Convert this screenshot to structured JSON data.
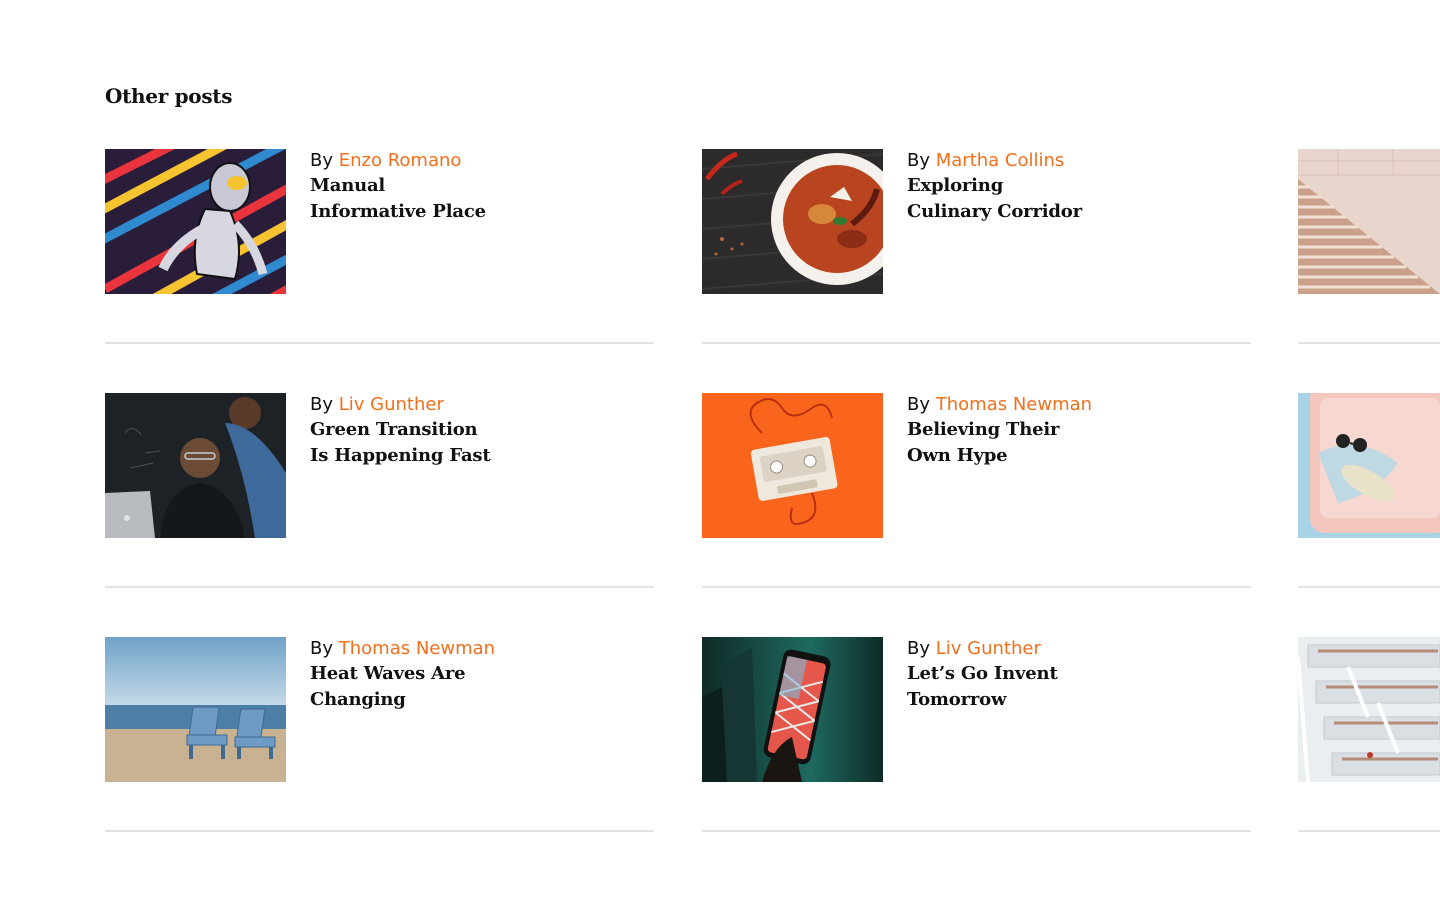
{
  "section": {
    "title": "Other posts"
  },
  "by_label": "By",
  "posts": [
    {
      "author": "Enzo Romano",
      "title_line1": "Manual",
      "title_line2": "Informative Place",
      "image": "colorful-robot-art"
    },
    {
      "author": "Martha Collins",
      "title_line1": "Exploring",
      "title_line2": "Culinary Corridor",
      "image": "curry-bowl"
    },
    {
      "author": "",
      "title_line1": "",
      "title_line2": "",
      "image": "stone-stairs"
    },
    {
      "author": "Liv Gunther",
      "title_line1": "Green Transition",
      "title_line2": "Is Happening Fast",
      "image": "people-at-laptop"
    },
    {
      "author": "Thomas Newman",
      "title_line1": "Believing Their",
      "title_line2": "Own Hype",
      "image": "cassette-tape-orange"
    },
    {
      "author": "",
      "title_line1": "",
      "title_line2": "",
      "image": "pink-suitcase"
    },
    {
      "author": "Thomas Newman",
      "title_line1": "Heat Waves Are",
      "title_line2": "Changing",
      "image": "beach-chairs"
    },
    {
      "author": "Liv Gunther",
      "title_line1": "Let’s Go Invent",
      "title_line2": "Tomorrow",
      "image": "smartphone-teal"
    },
    {
      "author": "",
      "title_line1": "",
      "title_line2": "",
      "image": "library-interior"
    }
  ],
  "colors": {
    "accent": "#f26f1c",
    "divider": "#e2e2e2",
    "text": "#111111"
  }
}
